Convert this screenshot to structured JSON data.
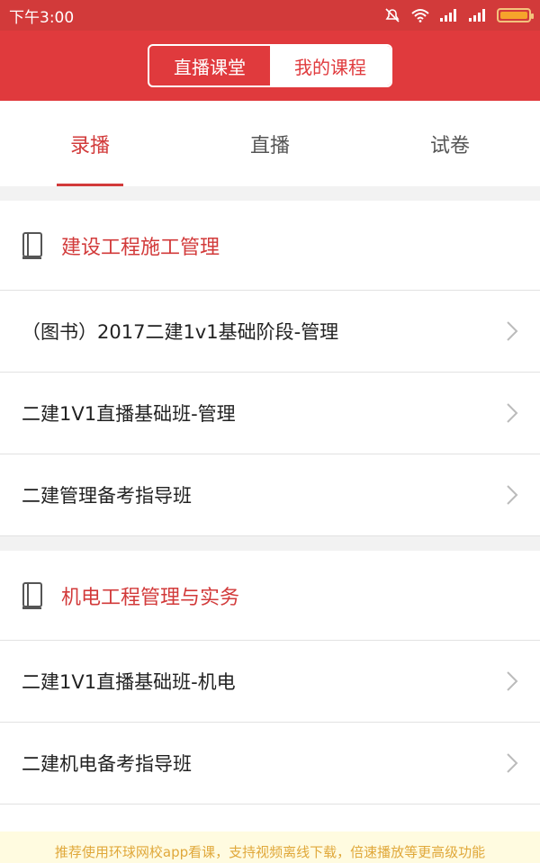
{
  "status": {
    "time": "下午3:00"
  },
  "header": {
    "segments": [
      "直播课堂",
      "我的课程"
    ],
    "active_segment": 1
  },
  "tabs": [
    "录播",
    "直播",
    "试卷"
  ],
  "sections": [
    {
      "title": "建设工程施工管理",
      "items": [
        "（图书）2017二建1v1基础阶段-管理",
        "二建1V1直播基础班-管理",
        "二建管理备考指导班"
      ]
    },
    {
      "title": "机电工程管理与实务",
      "items": [
        "二建1V1直播基础班-机电",
        "二建机电备考指导班",
        ""
      ]
    }
  ],
  "banner": {
    "text": "推荐使用环球网校app看课，支持视频离线下载，倍速播放等更高级功能"
  },
  "colors": {
    "brand": "#e03a3d",
    "accent": "#d23a3a",
    "banner_text": "#e0a83a"
  }
}
